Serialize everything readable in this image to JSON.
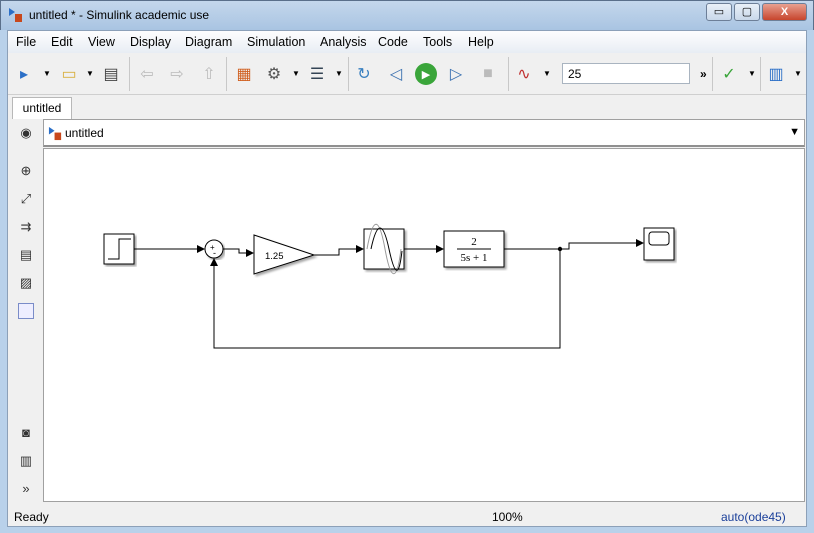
{
  "window": {
    "title": "untitled * - Simulink academic use",
    "controls": [
      "minimize",
      "maximize",
      "close"
    ]
  },
  "menu": [
    "File",
    "Edit",
    "View",
    "Display",
    "Diagram",
    "Simulation",
    "Analysis",
    "Code",
    "Tools",
    "Help"
  ],
  "toolbar": {
    "stop_time": "25",
    "more": "»"
  },
  "tabs": [
    {
      "label": "untitled"
    }
  ],
  "address": {
    "path": "untitled"
  },
  "diagram": {
    "gain_value": "1.25",
    "tf_numerator": "2",
    "tf_denominator": "5s + 1",
    "sum_signs": [
      "+",
      "-"
    ]
  },
  "status": {
    "state": "Ready",
    "zoom": "100%",
    "solver": "auto(ode45)"
  },
  "colors": {
    "run": "#3aa53a",
    "link": "#1a3f9a"
  }
}
